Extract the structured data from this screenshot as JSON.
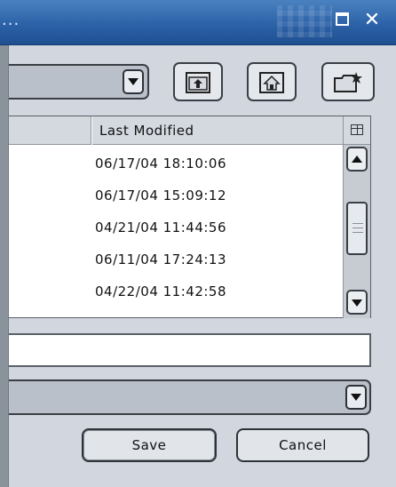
{
  "window": {
    "title_fragment": "...",
    "maximize_glyph": "□",
    "close_glyph": "✕"
  },
  "toolbar": {
    "look_in_value": "",
    "icons": [
      "up-folder-icon",
      "home-folder-icon",
      "new-folder-icon"
    ]
  },
  "file_list": {
    "columns": [
      "",
      "Last Modified"
    ],
    "rows": [
      {
        "name": "",
        "last_modified": "06/17/04 18:10:06"
      },
      {
        "name": "",
        "last_modified": "06/17/04 15:09:12"
      },
      {
        "name": "",
        "last_modified": "04/21/04 11:44:56"
      },
      {
        "name": "",
        "last_modified": "06/11/04 17:24:13"
      },
      {
        "name": "",
        "last_modified": "04/22/04 11:42:58"
      }
    ]
  },
  "file_name": {
    "value": ""
  },
  "file_type": {
    "value": ""
  },
  "buttons": {
    "save_label": "Save",
    "cancel_label": "Cancel"
  },
  "colors": {
    "titlebar": "#2c62a8",
    "panel": "#d2d7df"
  }
}
